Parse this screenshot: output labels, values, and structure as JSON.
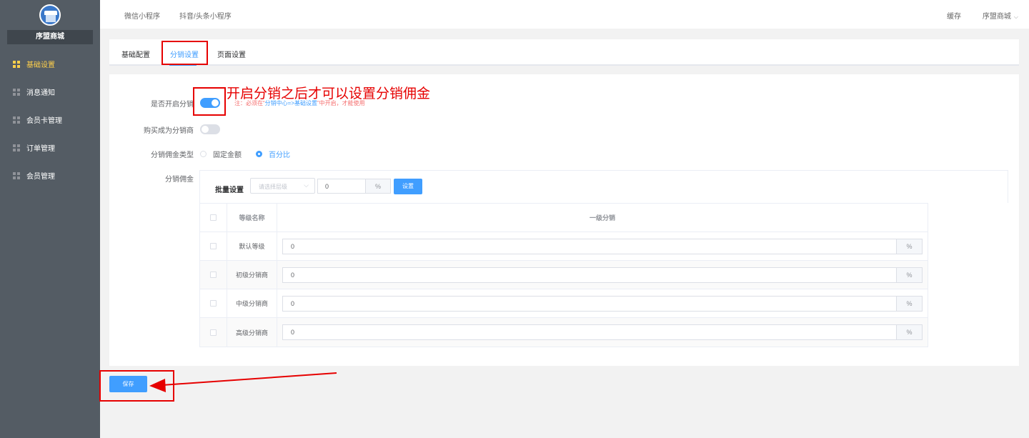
{
  "sidebar": {
    "brand_name": "序盟商城",
    "items": [
      {
        "label": "基础设置",
        "active": true
      },
      {
        "label": "消息通知",
        "active": false
      },
      {
        "label": "会员卡管理",
        "active": false
      },
      {
        "label": "订单管理",
        "active": false
      },
      {
        "label": "会员管理",
        "active": false
      }
    ]
  },
  "header": {
    "links": [
      "微信小程序",
      "抖音/头条小程序"
    ],
    "cache": "缓存",
    "store": "序盟商城"
  },
  "tabs": [
    {
      "label": "基础配置",
      "active": false
    },
    {
      "label": "分销设置",
      "active": true
    },
    {
      "label": "页面设置",
      "active": false
    }
  ],
  "form": {
    "enable_label": "是否开启分销",
    "enable_on": true,
    "note_prefix": "注：必须在“",
    "note_link": "分销中心=>基础设置",
    "note_suffix": "”中开启，才能使用",
    "buy_label": "购买成为分销商",
    "buy_on": false,
    "type_label": "分销佣金类型",
    "type_options": [
      "固定金额",
      "百分比"
    ],
    "type_selected": "百分比",
    "commission_label": "分销佣金",
    "batch_label": "批量设置",
    "select_placeholder": "请选择层级",
    "batch_value": "0",
    "percent": "%",
    "set_button": "设置"
  },
  "table": {
    "headers": [
      "等级名称",
      "一级分销"
    ],
    "rows": [
      {
        "name": "默认等级",
        "value": "0"
      },
      {
        "name": "初级分销商",
        "value": "0"
      },
      {
        "name": "中级分销商",
        "value": "0"
      },
      {
        "name": "高级分销商",
        "value": "0"
      }
    ]
  },
  "save_button": "保存",
  "annotation": "开启分销之后才可以设置分销佣金",
  "colors": {
    "primary": "#409eff",
    "annotation": "#e60000",
    "sidebar": "#545c64",
    "active_nav": "#ffd04b"
  }
}
